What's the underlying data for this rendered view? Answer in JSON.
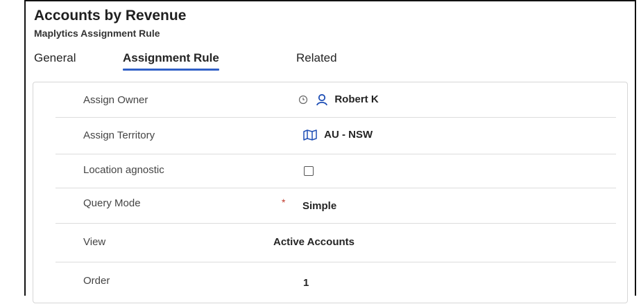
{
  "header": {
    "title": "Accounts by Revenue",
    "subtitle": "Maplytics Assignment Rule"
  },
  "tabs": [
    {
      "label": "General",
      "active": false
    },
    {
      "label": "Assignment Rule",
      "active": true
    },
    {
      "label": "Related",
      "active": false
    }
  ],
  "fields": {
    "assign_owner": {
      "label": "Assign Owner",
      "value": "Robert K",
      "icons": [
        "info-clock-icon",
        "person-icon"
      ]
    },
    "assign_territory": {
      "label": "Assign Territory",
      "value": "AU - NSW",
      "icon": "map-icon"
    },
    "location_agnostic": {
      "label": "Location agnostic",
      "checked": false
    },
    "query_mode": {
      "label": "Query Mode",
      "required_marker": "*",
      "value": "Simple"
    },
    "view": {
      "label": "View",
      "value": "Active Accounts"
    },
    "order": {
      "label": "Order",
      "value": "1"
    }
  },
  "colors": {
    "link": "#1f4fb5",
    "tab_underline": "#2f5fc6",
    "required": "#c0392b"
  }
}
